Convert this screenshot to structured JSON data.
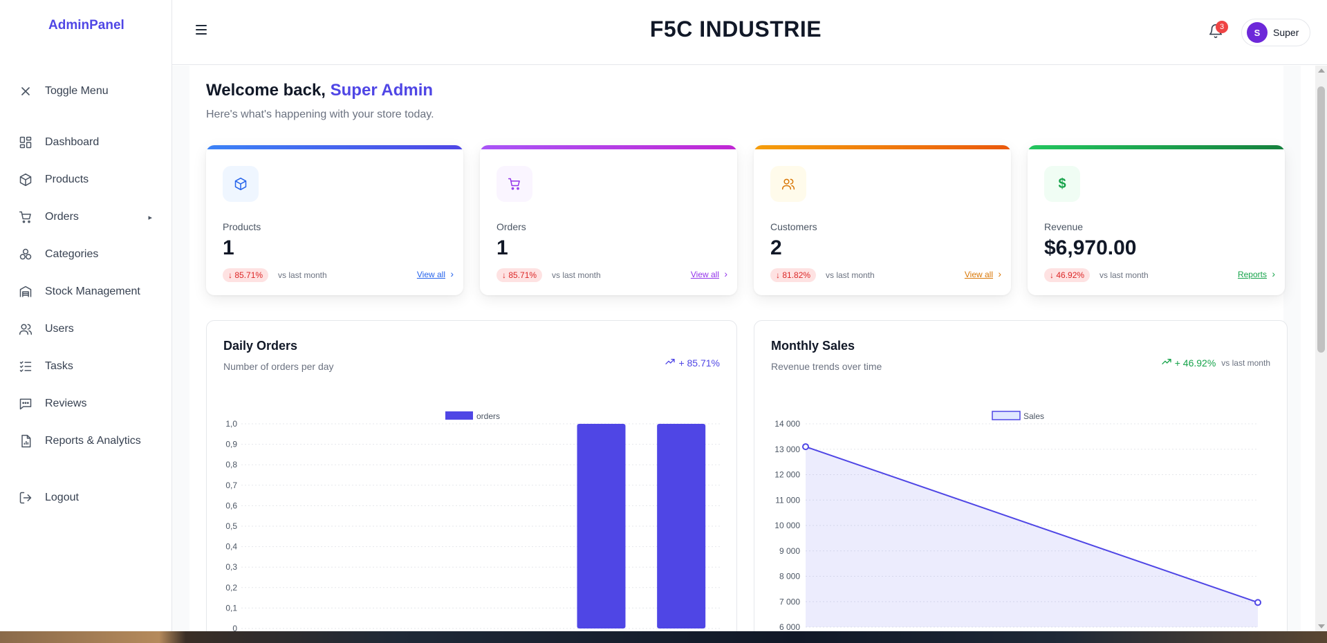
{
  "sidebar": {
    "brand": "AdminPanel",
    "toggle_label": "Toggle Menu",
    "items": [
      {
        "label": "Dashboard",
        "icon": "dashboard-icon"
      },
      {
        "label": "Products",
        "icon": "box-icon"
      },
      {
        "label": "Orders",
        "icon": "cart-icon"
      },
      {
        "label": "Categories",
        "icon": "categories-icon"
      },
      {
        "label": "Stock Management",
        "icon": "warehouse-icon"
      },
      {
        "label": "Users",
        "icon": "users-icon"
      },
      {
        "label": "Tasks",
        "icon": "tasks-icon"
      },
      {
        "label": "Reviews",
        "icon": "message-icon"
      },
      {
        "label": "Reports & Analytics",
        "icon": "report-icon"
      }
    ],
    "logout_label": "Logout"
  },
  "header": {
    "company": "F5C INDUSTRIE",
    "notification_count": "3",
    "user_initial": "S",
    "user_name": "Super"
  },
  "welcome": {
    "greeting": "Welcome back,",
    "name": "Super Admin",
    "subtitle": "Here's what's happening with your store today."
  },
  "stats": [
    {
      "label": "Products",
      "value": "1",
      "change": "85.71%",
      "vs": "vs last month",
      "link": "View all",
      "color": "#4f46e5"
    },
    {
      "label": "Orders",
      "value": "1",
      "change": "85.71%",
      "vs": "vs last month",
      "link": "View all",
      "color": "#9333ea"
    },
    {
      "label": "Customers",
      "value": "2",
      "change": "81.82%",
      "vs": "vs last month",
      "link": "View all",
      "color": "#ea580c"
    },
    {
      "label": "Revenue",
      "value": "$6,970.00",
      "change": "46.92%",
      "vs": "vs last month",
      "link": "Reports",
      "color": "#16a34a"
    }
  ],
  "daily_orders": {
    "title": "Daily Orders",
    "subtitle": "Number of orders per day",
    "trend": "+ 85.71%"
  },
  "monthly_sales": {
    "title": "Monthly Sales",
    "subtitle": "Revenue trends over time",
    "trend": "+ 46.92%",
    "trend_vs": "vs last month"
  },
  "chart_data": [
    {
      "type": "bar",
      "title": "Daily Orders",
      "series": [
        {
          "name": "orders",
          "values": [
            0,
            0,
            0,
            0,
            1,
            1
          ]
        }
      ],
      "categories": [
        "",
        "",
        "",
        "",
        "",
        ""
      ],
      "yticks": [
        "0",
        "0,1",
        "0,2",
        "0,3",
        "0,4",
        "0,5",
        "0,6",
        "0,7",
        "0,8",
        "0,9",
        "1,0"
      ],
      "ylim": [
        0,
        1.0
      ],
      "color": "#4f46e5",
      "legend": "top-center",
      "grid": true
    },
    {
      "type": "area",
      "title": "Monthly Sales",
      "series": [
        {
          "name": "Sales",
          "values": [
            13100,
            6970
          ]
        }
      ],
      "categories": [
        "",
        ""
      ],
      "yticks": [
        "6 000",
        "7 000",
        "8 000",
        "9 000",
        "10 000",
        "11 000",
        "12 000",
        "13 000",
        "14 000"
      ],
      "ylim": [
        6000,
        14000
      ],
      "color": "#4f46e5",
      "legend": "top-center",
      "grid": true
    }
  ]
}
